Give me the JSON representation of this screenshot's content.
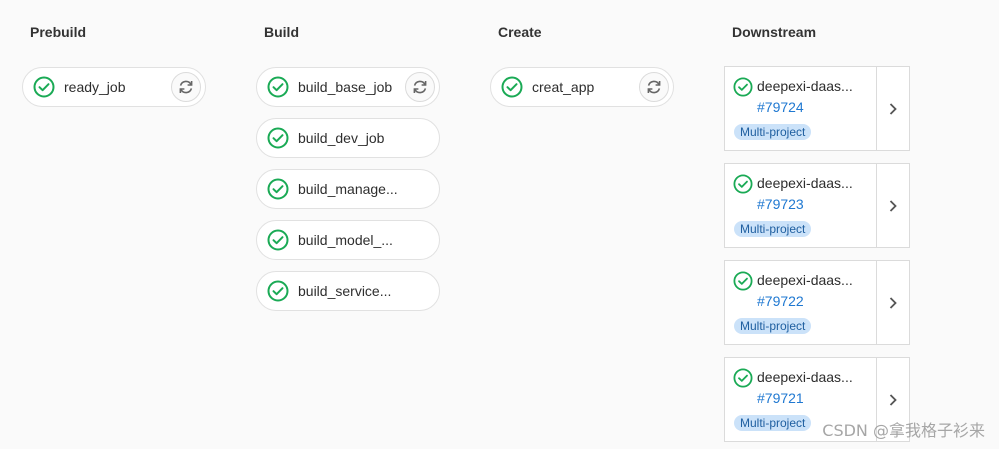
{
  "colors": {
    "success": "#1aaa55",
    "link": "#1f78d1",
    "badge_bg": "#cbe2f9"
  },
  "stages": [
    {
      "title": "Prebuild",
      "jobs": [
        {
          "name": "ready_job",
          "status": "success",
          "action": "retry-icon"
        }
      ]
    },
    {
      "title": "Build",
      "jobs": [
        {
          "name": "build_base_job",
          "status": "success",
          "action": "retry-icon"
        },
        {
          "name": "build_dev_job",
          "status": "success"
        },
        {
          "name": "build_manage...",
          "status": "success"
        },
        {
          "name": "build_model_...",
          "status": "success"
        },
        {
          "name": "build_service...",
          "status": "success"
        }
      ]
    },
    {
      "title": "Create",
      "jobs": [
        {
          "name": "creat_app",
          "status": "success",
          "action": "retry-icon"
        }
      ]
    },
    {
      "title": "Downstream",
      "pipelines": [
        {
          "name": "deepexi-daas...",
          "id": "#79724",
          "badge": "Multi-project",
          "status": "success"
        },
        {
          "name": "deepexi-daas...",
          "id": "#79723",
          "badge": "Multi-project",
          "status": "success"
        },
        {
          "name": "deepexi-daas...",
          "id": "#79722",
          "badge": "Multi-project",
          "status": "success"
        },
        {
          "name": "deepexi-daas...",
          "id": "#79721",
          "badge": "Multi-project",
          "status": "success"
        }
      ]
    }
  ],
  "watermark": "CSDN @拿我格子衫来"
}
